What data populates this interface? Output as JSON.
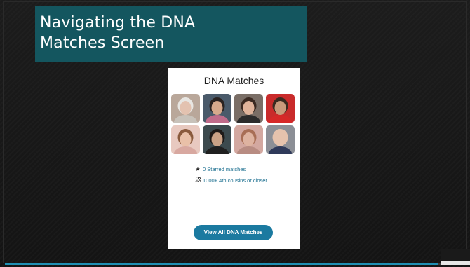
{
  "slide": {
    "title_line_1": "Navigating the DNA",
    "title_line_2": "Matches Screen",
    "progress_fraction": 0.94
  },
  "card": {
    "title": "DNA Matches",
    "photos": [
      {
        "icon": "elderly-woman-photo",
        "bg": "#b9a79a",
        "skin": "#e3c2b0",
        "hair": "#e8e6e2",
        "cloth": "#c8c2ba"
      },
      {
        "icon": "couple-photo",
        "bg": "#4a5a6a",
        "skin": "#d7a98c",
        "hair": "#2a2220",
        "cloth": "#c06b8a"
      },
      {
        "icon": "woman-smiling-photo",
        "bg": "#7a6e66",
        "skin": "#e0b49b",
        "hair": "#3b2a22",
        "cloth": "#2b2b2b"
      },
      {
        "icon": "man-red-shirt-photo",
        "bg": "#c92b2b",
        "skin": "#c99a7c",
        "hair": "#3a2a20",
        "cloth": "#d62828"
      },
      {
        "icon": "woman-pink-photo",
        "bg": "#e8c9c0",
        "skin": "#e9c0a8",
        "hair": "#8a5a3c",
        "cloth": "#d8a8a0"
      },
      {
        "icon": "woman-sunglasses-photo",
        "bg": "#3c4a4e",
        "skin": "#caa286",
        "hair": "#1e1a18",
        "cloth": "#202020"
      },
      {
        "icon": "blurred-portrait-photo",
        "bg": "#d3a8a0",
        "skin": "#deb3a0",
        "hair": "#a86e55",
        "cloth": "#b88c82"
      },
      {
        "icon": "man-bald-photo",
        "bg": "#8c8f96",
        "skin": "#e6c3ad",
        "hair": "#e6c3ad",
        "cloth": "#2f3a5a"
      }
    ],
    "stats": {
      "starred_icon": "★",
      "starred_label": "0 Starred matches",
      "cousins_icon": "👥",
      "cousins_label": "1000+ 4th cousins or closer"
    },
    "view_all_label": "View All DNA Matches"
  },
  "colors": {
    "title_bg": "#14565f",
    "link": "#1a6e8f",
    "button": "#1b7aa0",
    "progress": "#1e8fb3"
  }
}
